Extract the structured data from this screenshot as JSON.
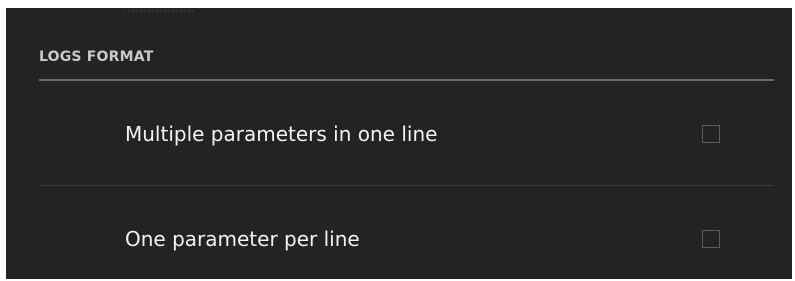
{
  "section": {
    "title": "LOGS FORMAT"
  },
  "options": [
    {
      "label": "Multiple parameters in one line",
      "checked": false
    },
    {
      "label": "One parameter per line",
      "checked": false
    }
  ],
  "colors": {
    "background": "#232323",
    "header_text": "#c9c9c9",
    "item_text": "#f2f2f2",
    "divider": "#6a6a6a",
    "checkbox_border": "#5d5d5d"
  }
}
